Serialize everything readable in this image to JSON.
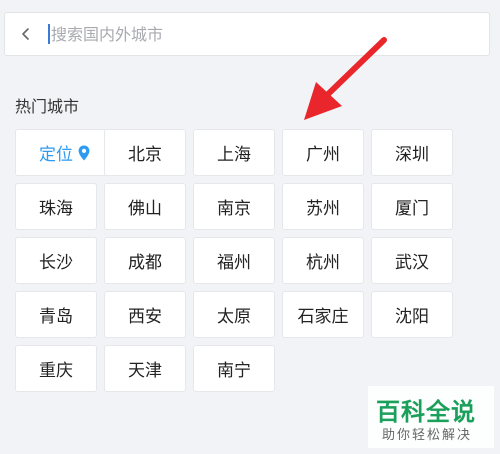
{
  "search": {
    "placeholder": "搜索国内外城市",
    "value": ""
  },
  "hot_cities": {
    "title": "热门城市",
    "locate_label": "定位",
    "cities": [
      "北京",
      "上海",
      "广州",
      "深圳",
      "珠海",
      "佛山",
      "南京",
      "苏州",
      "厦门",
      "长沙",
      "成都",
      "福州",
      "杭州",
      "武汉",
      "青岛",
      "西安",
      "太原",
      "石家庄",
      "沈阳",
      "重庆",
      "天津",
      "南宁"
    ]
  },
  "watermark": {
    "logo": "百科全说",
    "slogan": "助你轻松解决"
  },
  "colors": {
    "accent": "#2e9bf2",
    "arrow": "#e8262b",
    "watermark": "#1aa05a"
  },
  "icons": {
    "back": "chevron-left-icon",
    "locate": "location-pin-icon",
    "annotation": "red-arrow-icon"
  }
}
